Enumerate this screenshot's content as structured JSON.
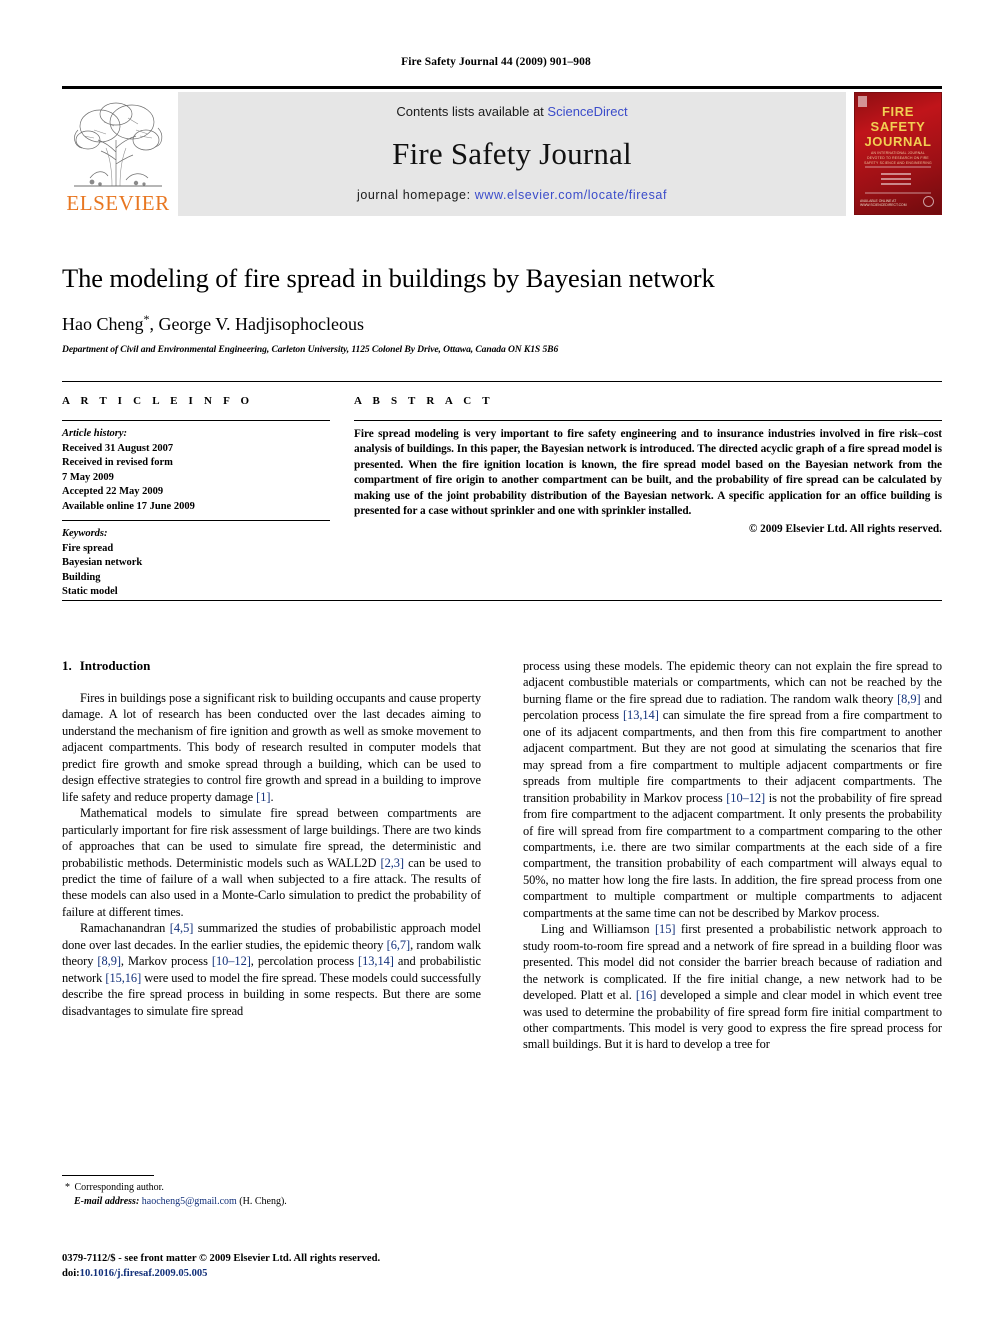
{
  "running_head": "Fire Safety Journal 44 (2009) 901–908",
  "masthead": {
    "contents_prefix": "Contents lists available at ",
    "sciencedirect": "ScienceDirect",
    "journal_title": "Fire Safety Journal",
    "homepage_prefix": "journal homepage: ",
    "homepage_url": "www.elsevier.com/locate/firesaf",
    "publisher": "ELSEVIER",
    "cover": {
      "line1": "FIRE",
      "line2": "SAFETY",
      "line3": "JOURNAL",
      "subtitle": "AN INTERNATIONAL JOURNAL DEVOTED TO RESEARCH ON FIRE SAFETY SCIENCE AND ENGINEERING",
      "footer": "AVAILABLE ONLINE AT WWW.SCIENCEDIRECT.COM"
    },
    "link_color": "#3b4cca",
    "elsevier_orange": "#E87722",
    "cover_red": "#c0141a",
    "cover_gold": "#f2cf52"
  },
  "title": "The modeling of fire spread in buildings by Bayesian network",
  "authors": "Hao Cheng",
  "authors_star": "*",
  "authors_rest": ", George V. Hadjisophocleous",
  "affiliation": "Department of Civil and Environmental Engineering, Carleton University, 1125 Colonel By Drive, Ottawa, Canada ON K1S 5B6",
  "article_info": {
    "heading": "A R T I C L E   I N F O",
    "history_label": "Article history:",
    "history": [
      "Received 31 August 2007",
      "Received in revised form",
      "7 May 2009",
      "Accepted 22 May 2009",
      "Available online 17 June 2009"
    ],
    "keywords_label": "Keywords:",
    "keywords": [
      "Fire spread",
      "Bayesian network",
      "Building",
      "Static model"
    ]
  },
  "abstract": {
    "heading": "A B S T R A C T",
    "text": "Fire spread modeling is very important to fire safety engineering and to insurance industries involved in fire risk–cost analysis of buildings. In this paper, the Bayesian network is introduced. The directed acyclic graph of a fire spread model is presented. When the fire ignition location is known, the fire spread model based on the Bayesian network from the compartment of fire origin to another compartment can be built, and the probability of fire spread can be calculated by making use of the joint probability distribution of the Bayesian network. A specific application for an office building is presented for a case without sprinkler and one with sprinkler installed.",
    "copyright": "© 2009 Elsevier Ltd. All rights reserved."
  },
  "body": {
    "section_number": "1.",
    "section_title": "Introduction",
    "left_paragraphs": [
      [
        {
          "t": "Fires in buildings pose a significant risk to building occupants and cause property damage. A lot of research has been conducted over the last decades aiming to understand the mechanism of fire ignition and growth as well as smoke movement to adjacent compartments. This body of research resulted in computer models that predict fire growth and smoke spread through a building, which can be used to design effective strategies to control fire growth and spread in a building to improve life safety and reduce property damage "
        },
        {
          "t": "[1]",
          "cite": true
        },
        {
          "t": "."
        }
      ],
      [
        {
          "t": "Mathematical models to simulate fire spread between compartments are particularly important for fire risk assessment of large buildings. There are two kinds of approaches that can be used to simulate fire spread, the deterministic and probabilistic methods. Deterministic models such as WALL2D "
        },
        {
          "t": "[2,3]",
          "cite": true
        },
        {
          "t": " can be used to predict the time of failure of a wall when subjected to a fire attack. The results of these models can also used in a Monte-Carlo simulation to predict the probability of failure at different times."
        }
      ],
      [
        {
          "t": "Ramachanandran "
        },
        {
          "t": "[4,5]",
          "cite": true
        },
        {
          "t": " summarized the studies of probabilistic approach model done over last decades. In the earlier studies, the epidemic theory "
        },
        {
          "t": "[6,7]",
          "cite": true
        },
        {
          "t": ", random walk theory "
        },
        {
          "t": "[8,9]",
          "cite": true
        },
        {
          "t": ", Markov process "
        },
        {
          "t": "[10–12]",
          "cite": true
        },
        {
          "t": ", percolation process "
        },
        {
          "t": "[13,14]",
          "cite": true
        },
        {
          "t": " and probabilistic network "
        },
        {
          "t": "[15,16]",
          "cite": true
        },
        {
          "t": " were used to model the fire spread. These models could successfully describe the fire spread process in building in some respects. But there are some disadvantages to simulate fire spread"
        }
      ]
    ],
    "right_paragraphs": [
      [
        {
          "t": "process using these models. The epidemic theory can not explain the fire spread to adjacent combustible materials or compartments, which can not be reached by the burning flame or the fire spread due to radiation. The random walk theory "
        },
        {
          "t": "[8,9]",
          "cite": true
        },
        {
          "t": " and percolation process "
        },
        {
          "t": "[13,14]",
          "cite": true
        },
        {
          "t": " can simulate the fire spread from a fire compartment to one of its adjacent compartments, and then from this fire compartment to another adjacent compartment. But they are not good at simulating the scenarios that fire may spread from a fire compartment to multiple adjacent compartments or fire spreads from multiple fire compartments to their adjacent compartments. The transition probability in Markov process "
        },
        {
          "t": "[10–12]",
          "cite": true
        },
        {
          "t": " is not the probability of fire spread from fire compartment to the adjacent compartment. It only presents the probability of fire will spread from fire compartment to a compartment comparing to the other compartments, i.e. there are two similar compartments at the each side of a fire compartment, the transition probability of each compartment will always equal to 50%, no matter how long the fire lasts. In addition, the fire spread process from one compartment to multiple compartment or multiple compartments to adjacent compartments at the same time can not be described by Markov process."
        }
      ],
      [
        {
          "t": "Ling and Williamson "
        },
        {
          "t": "[15]",
          "cite": true
        },
        {
          "t": " first presented a probabilistic network approach to study room-to-room fire spread and a network of fire spread in a building floor was presented. This model did not consider the barrier breach because of radiation and the network is complicated. If the fire initial change, a new network had to be developed. Platt et al. "
        },
        {
          "t": "[16]",
          "cite": true
        },
        {
          "t": " developed a simple and clear model in which event tree was used to determine the probability of fire spread form fire initial compartment to other compartments. This model is very good to express the fire spread process for small buildings. But it is hard to develop a tree for"
        }
      ]
    ],
    "cite_color": "#12307a"
  },
  "footnotes": {
    "corresponding_star": "*",
    "corresponding": " Corresponding author.",
    "email_label": "E-mail address:",
    "email": "haocheng5@gmail.com",
    "email_owner": "(H. Cheng)."
  },
  "imprint": {
    "issn_line": "0379-7112/$ - see front matter © 2009 Elsevier Ltd. All rights reserved.",
    "doi_label": "doi:",
    "doi_value": "10.1016/j.firesaf.2009.05.005"
  }
}
